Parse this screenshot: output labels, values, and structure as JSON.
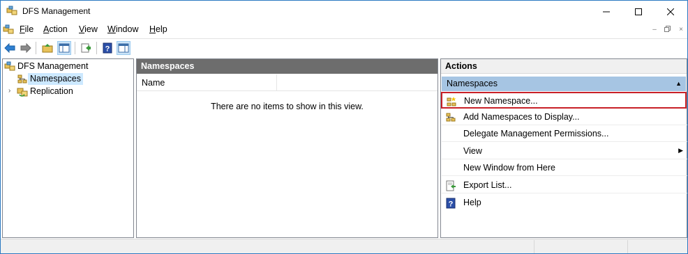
{
  "window": {
    "title": "DFS Management"
  },
  "menu": {
    "items": [
      {
        "key": "F",
        "rest": "ile"
      },
      {
        "key": "A",
        "rest": "ction"
      },
      {
        "key": "V",
        "rest": "iew"
      },
      {
        "key": "W",
        "rest": "indow"
      },
      {
        "key": "H",
        "rest": "elp"
      }
    ],
    "mdi": {
      "minimize": "–",
      "restore": "🗗",
      "close": "×"
    }
  },
  "tree": {
    "root": "DFS Management",
    "items": [
      {
        "label": "Namespaces",
        "selected": true
      },
      {
        "label": "Replication",
        "expander": "›"
      }
    ]
  },
  "center": {
    "header": "Namespaces",
    "columns": [
      "Name"
    ],
    "empty_message": "There are no items to show in this view."
  },
  "actions": {
    "header": "Actions",
    "section": "Namespaces",
    "items": [
      {
        "label": "New Namespace...",
        "icon": "new-namespace-icon",
        "highlighted": true
      },
      {
        "label": "Add Namespaces to Display...",
        "icon": "add-namespaces-icon"
      },
      {
        "label": "Delegate Management Permissions...",
        "icon": ""
      },
      {
        "label": "View",
        "icon": "",
        "submenu": true
      },
      {
        "label": "New Window from Here",
        "icon": ""
      },
      {
        "label": "Export List...",
        "icon": "export-list-icon"
      },
      {
        "label": "Help",
        "icon": "help-icon"
      }
    ]
  },
  "colors": {
    "accent_border": "#2b79c2",
    "center_header_bg": "#6d6d6d",
    "actions_section_bg": "#a6c5e3",
    "selected_bg": "#cce8ff",
    "highlight_border": "#c82027"
  }
}
